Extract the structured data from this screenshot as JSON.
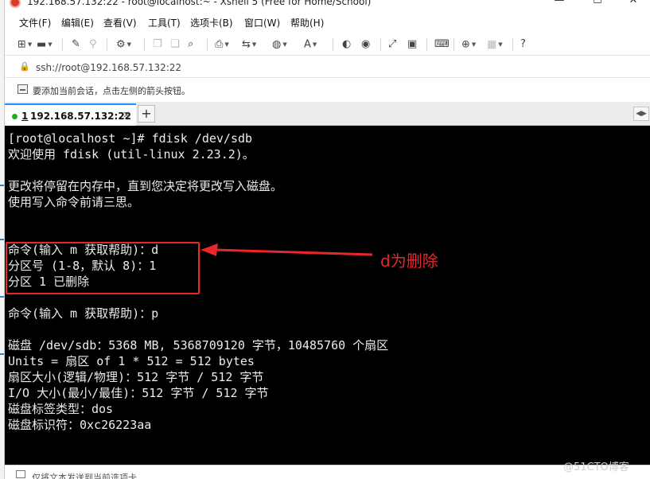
{
  "window": {
    "title": "192.168.57.132:22 - root@localhost:~ - Xshell 5 (Free for Home/School)",
    "controls": {
      "minimize": "—",
      "maximize": "☐",
      "close": "✕"
    }
  },
  "menu": {
    "items": [
      "文件(F)",
      "编辑(E)",
      "查看(V)",
      "工具(T)",
      "选项卡(B)",
      "窗口(W)",
      "帮助(H)"
    ]
  },
  "toolbar": {
    "icons": [
      "new-session-icon",
      "open-folder-icon",
      "properties-icon",
      "disconnect-icon",
      "session-manager-icon",
      "copy-icon",
      "paste-icon",
      "find-icon",
      "print-icon",
      "transfer-icon",
      "globe-icon",
      "font-icon",
      "xftp-icon",
      "xmanager-icon",
      "fullscreen-icon",
      "lock-icon",
      "keyboard-icon",
      "add-tab-icon",
      "layout-icon",
      "help-icon"
    ]
  },
  "address": {
    "value": "ssh://root@192.168.57.132:22"
  },
  "hint": {
    "text": "要添加当前会话，点击左侧的箭头按钮。"
  },
  "tabs": [
    {
      "number": "1",
      "label": "192.168.57.132:22",
      "status_color": "#1cb01c",
      "close": "×"
    }
  ],
  "new_tab_label": "+",
  "terminal": {
    "lines": [
      "[root@localhost ~]# fdisk /dev/sdb",
      "欢迎使用 fdisk (util-linux 2.23.2)。",
      "",
      "更改将停留在内存中，直到您决定将更改写入磁盘。",
      "使用写入命令前请三思。",
      "",
      "",
      "命令(输入 m 获取帮助)：d",
      "分区号 (1-8，默认 8)：1",
      "分区 1 已删除",
      "",
      "命令(输入 m 获取帮助)：p",
      "",
      "磁盘 /dev/sdb：5368 MB, 5368709120 字节，10485760 个扇区",
      "Units = 扇区 of 1 * 512 = 512 bytes",
      "扇区大小(逻辑/物理)：512 字节 / 512 字节",
      "I/O 大小(最小/最佳)：512 字节 / 512 字节",
      "磁盘标签类型：dos",
      "磁盘标识符：0xc26223aa"
    ]
  },
  "annotation": {
    "label": "d为删除",
    "color": "#e8262c"
  },
  "send_bar": {
    "text": "仅将文本发送到当前选项卡"
  },
  "watermark": "@51CTO博客"
}
